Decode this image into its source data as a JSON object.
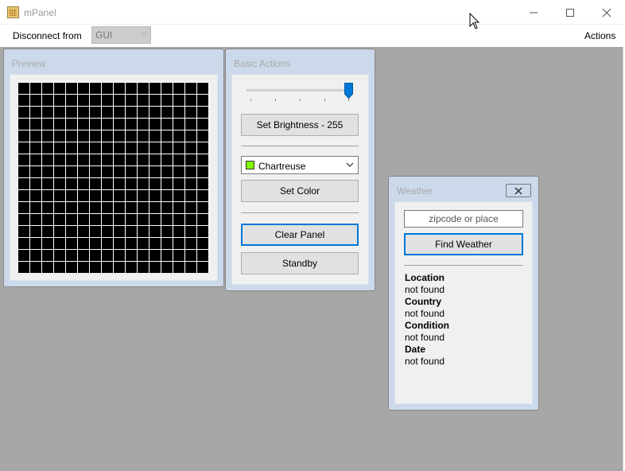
{
  "window": {
    "title": "mPanel"
  },
  "menubar": {
    "disconnect_label": "Disconnect from",
    "target_value": "GUI",
    "actions_label": "Actions"
  },
  "preview": {
    "title": "Preview",
    "grid_size": 16
  },
  "basic_actions": {
    "title": "Basic Actions",
    "brightness": 255,
    "brightness_max": 255,
    "set_brightness_label": "Set Brightness - 255",
    "color_value": "Chartreuse",
    "color_swatch": "#7fff00",
    "set_color_label": "Set Color",
    "clear_panel_label": "Clear Panel",
    "standby_label": "Standby"
  },
  "weather": {
    "title": "Weather",
    "zip_placeholder": "zipcode or place",
    "find_label": "Find Weather",
    "location_label": "Location",
    "location_value": "not found",
    "country_label": "Country",
    "country_value": "not found",
    "condition_label": "Condition",
    "condition_value": "not found",
    "date_label": "Date",
    "date_value": "not found"
  },
  "colors": {
    "accent": "#0078d7",
    "workspace": "#a7a7a7",
    "child_frame": "#ccd9ea"
  },
  "icons": [
    "app-icon",
    "minimize-icon",
    "maximize-icon",
    "close-icon",
    "chevron-down-icon",
    "cursor-icon"
  ]
}
